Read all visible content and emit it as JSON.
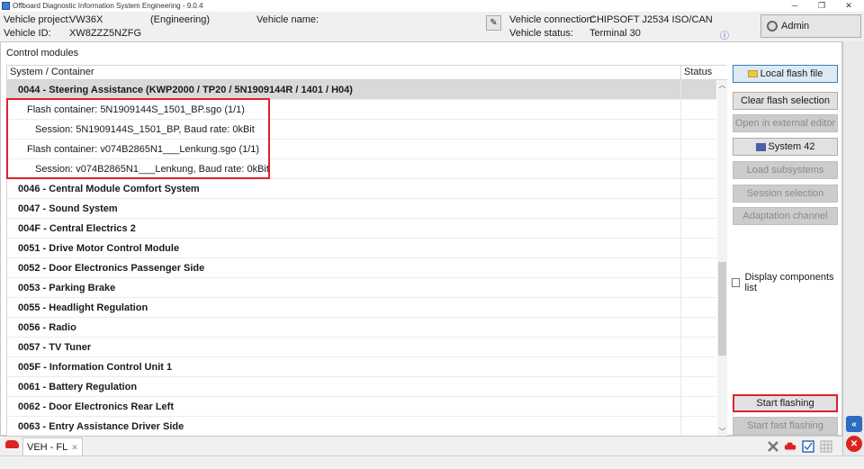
{
  "window": {
    "title": "Offboard Diagnostic Information System Engineering - 9.0.4",
    "controls": [
      "─",
      "❐",
      "✕"
    ]
  },
  "header": {
    "vehicle_project_label": "Vehicle project:",
    "vehicle_project_value": "VW36X",
    "mode": "(Engineering)",
    "vehicle_name_label": "Vehicle name:",
    "vehicle_id_label": "Vehicle ID:",
    "vehicle_id_value": "XW8ZZZ5NZFG",
    "vehicle_connection_label": "Vehicle connection:",
    "vehicle_connection_value": "CHIPSOFT J2534 ISO/CAN",
    "vehicle_status_label": "Vehicle status:",
    "vehicle_status_value": "Terminal 30",
    "admin_label": "Admin"
  },
  "panel": {
    "title": "Control modules",
    "columns": [
      "System / Container",
      "Status"
    ]
  },
  "rows": [
    {
      "text": "0044 - Steering Assistance  (KWP2000 / TP20 / 5N1909144R / 1401 / H04)",
      "kind": "bold",
      "selected": true
    },
    {
      "text": "Flash container: 5N1909144S_1501_BP.sgo (1/1)",
      "kind": "sub1"
    },
    {
      "text": "Session: 5N1909144S_1501_BP, Baud rate: 0kBit",
      "kind": "sub2"
    },
    {
      "text": "Flash container: v074B2865N1___Lenkung.sgo (1/1)",
      "kind": "sub1"
    },
    {
      "text": "Session: v074B2865N1___Lenkung, Baud rate: 0kBit",
      "kind": "sub2"
    },
    {
      "text": "0046 - Central Module Comfort System",
      "kind": "bold"
    },
    {
      "text": "0047 - Sound System",
      "kind": "bold"
    },
    {
      "text": "004F - Central Electrics 2",
      "kind": "bold"
    },
    {
      "text": "0051 - Drive Motor Control Module",
      "kind": "bold"
    },
    {
      "text": "0052 - Door Electronics Passenger Side",
      "kind": "bold"
    },
    {
      "text": "0053 - Parking Brake",
      "kind": "bold"
    },
    {
      "text": "0055 - Headlight Regulation",
      "kind": "bold"
    },
    {
      "text": "0056 - Radio",
      "kind": "bold"
    },
    {
      "text": "0057 - TV Tuner",
      "kind": "bold"
    },
    {
      "text": "005F - Information Control Unit 1",
      "kind": "bold"
    },
    {
      "text": "0061 - Battery Regulation",
      "kind": "bold"
    },
    {
      "text": "0062 - Door Electronics Rear Left",
      "kind": "bold"
    },
    {
      "text": "0063 - Entry Assistance Driver Side",
      "kind": "bold"
    }
  ],
  "buttons": {
    "local_flash_file": "Local flash file",
    "clear_flash_selection": "Clear flash selection",
    "open_external_editor": "Open in external editor",
    "system42": "System 42",
    "load_subsystems": "Load subsystems",
    "session_selection": "Session selection",
    "adaptation_channel": "Adaptation channel",
    "display_components": "Display components list",
    "start_flashing": "Start flashing",
    "start_fast_flashing": "Start fast flashing"
  },
  "bottom": {
    "tab_label": "VEH - FL",
    "tab_close": "✕"
  },
  "colors": {
    "highlight_red": "#e0202c",
    "selected_row": "#d9d9d9",
    "primary_border": "#3c7fb1"
  }
}
